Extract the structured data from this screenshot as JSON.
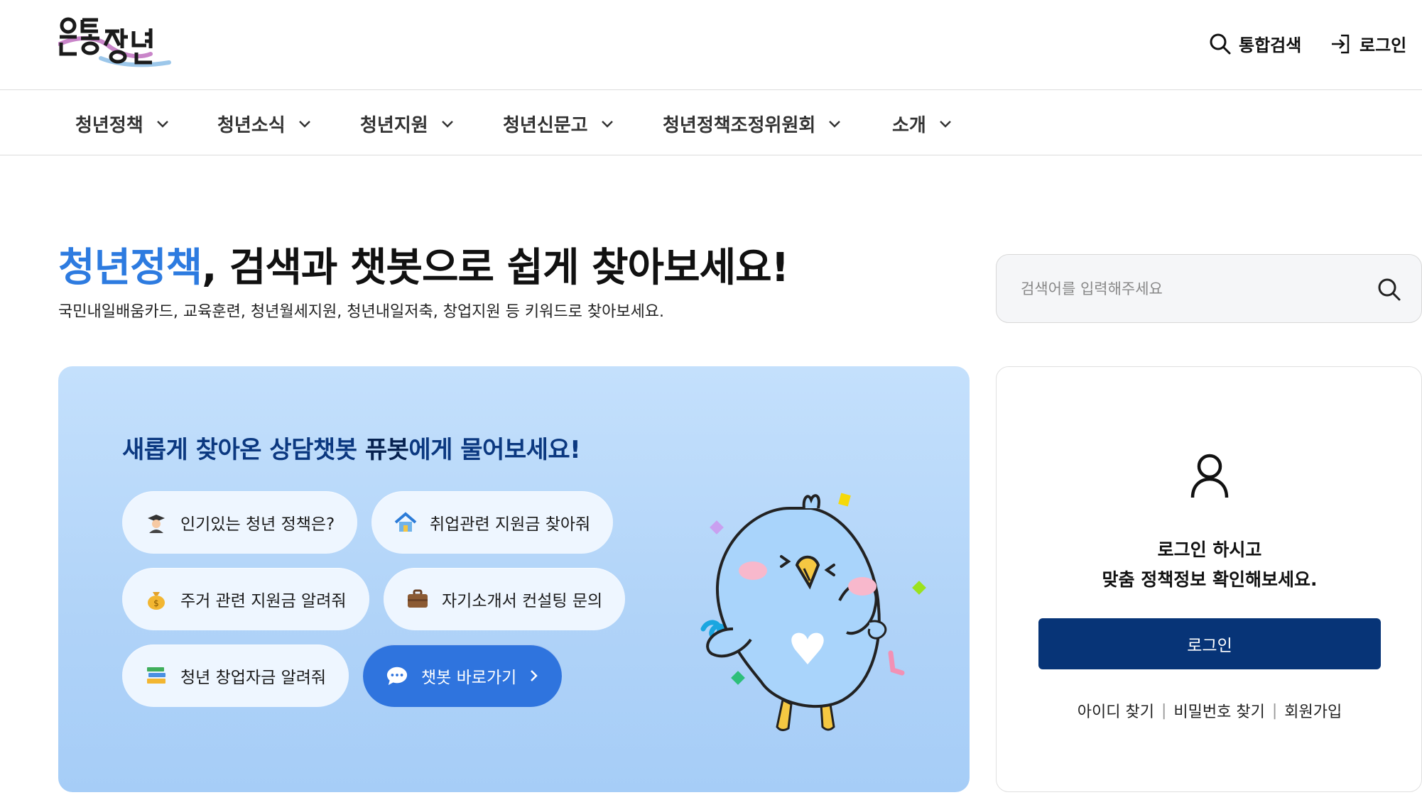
{
  "header": {
    "logo_text": "온통청년",
    "search_label": "통합검색",
    "login_label": "로그인"
  },
  "gnb": {
    "items": [
      {
        "label": "청년정책"
      },
      {
        "label": "청년소식"
      },
      {
        "label": "청년지원"
      },
      {
        "label": "청년신문고"
      },
      {
        "label": "청년정책조정위원회"
      },
      {
        "label": "소개"
      }
    ]
  },
  "hero": {
    "title_accent": "청년정책",
    "title_rest": ", 검색과 챗봇으로 쉽게 찾아보세요!",
    "subtitle": "국민내일배움카드, 교육훈련, 청년월세지원, 청년내일저축, 창업지원 등 키워드로 찾아보세요.",
    "search_placeholder": "검색어를 입력해주세요"
  },
  "chatbot": {
    "title_pre": "새롭게 찾아온 상담챗봇 ",
    "title_name": "퓨봇",
    "title_post": "에게 물어보세요!",
    "chips": [
      {
        "label": "인기있는 청년 정책은?",
        "icon": "graduate-icon"
      },
      {
        "label": "취업관련 지원금 찾아줘",
        "icon": "house-icon"
      },
      {
        "label": "주거 관련 지원금 알려줘",
        "icon": "money-bag-icon"
      },
      {
        "label": "자기소개서 컨설팅 문의",
        "icon": "briefcase-icon"
      },
      {
        "label": "청년 창업자금 알려줘",
        "icon": "books-icon"
      }
    ],
    "cta_label": "챗봇 바로가기"
  },
  "login_card": {
    "message_line1": "로그인 하시고",
    "message_line2": "맞춤 정책정보 확인해보세요.",
    "button_label": "로그인",
    "link_find_id": "아이디 찾기",
    "link_find_pw": "비밀번호 찾기",
    "link_signup": "회원가입",
    "separator": "|"
  },
  "colors": {
    "accent": "#2d7be0",
    "navy": "#073477",
    "chat_bg": "#b0d3f8",
    "chat_title": "#0b3880",
    "chip_bg": "#eef6ff",
    "cta_bg": "#2f74de"
  }
}
